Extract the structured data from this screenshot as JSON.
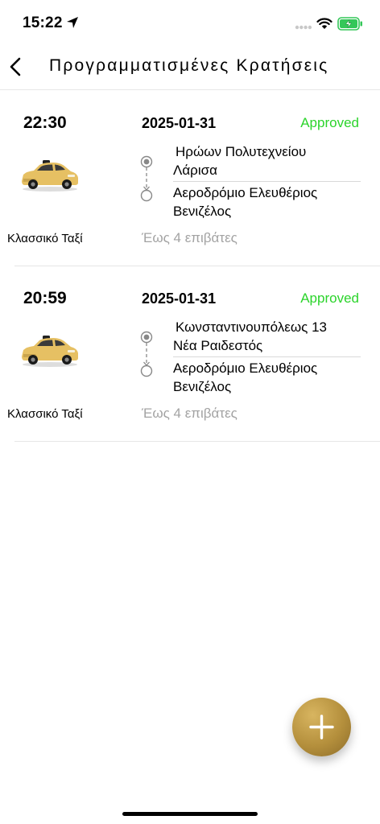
{
  "status_bar": {
    "time": "15:22"
  },
  "header": {
    "title": "Προγραμματισμένες Κρατήσεις",
    "back_icon": "chevron-left-icon"
  },
  "bookings": [
    {
      "time": "22:30",
      "date": "2025-01-31",
      "status": "Approved",
      "car_type": "Κλασσικό Ταξί",
      "pickup_line1": "Ηρώων Πολυτεχνείου",
      "pickup_line2": "Λάρισα",
      "dropoff_line1": "Αεροδρόμιο Ελευθέριος",
      "dropoff_line2": "Βενιζέλος",
      "passengers": "Έως 4 επιβάτες"
    },
    {
      "time": "20:59",
      "date": "2025-01-31",
      "status": "Approved",
      "car_type": "Κλασσικό Ταξί",
      "pickup_line1": "Κωνσταντινουπόλεως 13",
      "pickup_line2": "Νέα Ραιδεστός",
      "dropoff_line1": "Αεροδρόμιο Ελευθέριος",
      "dropoff_line2": "Βενιζέλος",
      "passengers": "Έως 4 επιβάτες"
    }
  ],
  "fab": {
    "icon": "plus-icon"
  },
  "colors": {
    "approved": "#2bd42b",
    "fab_gold": "#b48f3c",
    "muted_text": "#a3a3a3"
  }
}
